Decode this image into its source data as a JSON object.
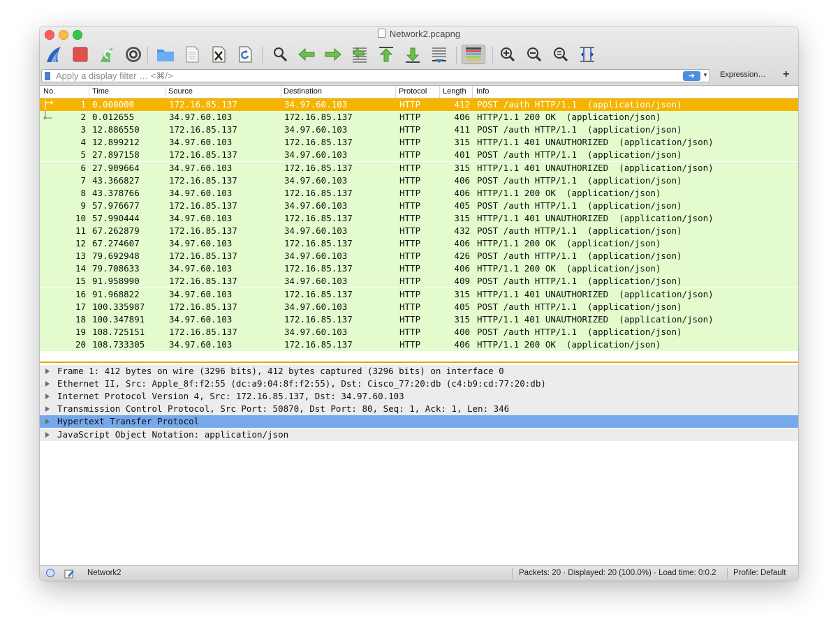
{
  "window": {
    "title": "Network2.pcapng"
  },
  "toolbar": {
    "icons": [
      "shark-fin-icon",
      "stop-icon",
      "restart-icon",
      "gear-icon",
      "folder-icon",
      "file-icon",
      "close-file-icon",
      "reload-icon",
      "search-icon",
      "back-arrow-icon",
      "forward-arrow-icon",
      "go-to-packet-icon",
      "first-packet-icon",
      "last-packet-icon",
      "autoscroll-icon",
      "colorize-icon",
      "zoom-in-icon",
      "zoom-out-icon",
      "zoom-normal-icon",
      "resize-columns-icon"
    ]
  },
  "filter": {
    "placeholder": "Apply a display filter … <⌘/>",
    "expression_label": "Expression…",
    "plus_label": "+"
  },
  "columns": {
    "no": "No.",
    "time": "Time",
    "source": "Source",
    "destination": "Destination",
    "protocol": "Protocol",
    "length": "Length",
    "info": "Info"
  },
  "packets": [
    {
      "no": "1",
      "time": "0.000000",
      "src": "172.16.85.137",
      "dst": "34.97.60.103",
      "proto": "HTTP",
      "len": "412",
      "info": "POST /auth HTTP/1.1  (application/json)"
    },
    {
      "no": "2",
      "time": "0.012655",
      "src": "34.97.60.103",
      "dst": "172.16.85.137",
      "proto": "HTTP",
      "len": "406",
      "info": "HTTP/1.1 200 OK  (application/json)"
    },
    {
      "no": "3",
      "time": "12.886550",
      "src": "172.16.85.137",
      "dst": "34.97.60.103",
      "proto": "HTTP",
      "len": "411",
      "info": "POST /auth HTTP/1.1  (application/json)"
    },
    {
      "no": "4",
      "time": "12.899212",
      "src": "34.97.60.103",
      "dst": "172.16.85.137",
      "proto": "HTTP",
      "len": "315",
      "info": "HTTP/1.1 401 UNAUTHORIZED  (application/json)"
    },
    {
      "no": "5",
      "time": "27.897158",
      "src": "172.16.85.137",
      "dst": "34.97.60.103",
      "proto": "HTTP",
      "len": "401",
      "info": "POST /auth HTTP/1.1  (application/json)"
    },
    {
      "no": "6",
      "time": "27.909664",
      "src": "34.97.60.103",
      "dst": "172.16.85.137",
      "proto": "HTTP",
      "len": "315",
      "info": "HTTP/1.1 401 UNAUTHORIZED  (application/json)"
    },
    {
      "no": "7",
      "time": "43.366827",
      "src": "172.16.85.137",
      "dst": "34.97.60.103",
      "proto": "HTTP",
      "len": "406",
      "info": "POST /auth HTTP/1.1  (application/json)"
    },
    {
      "no": "8",
      "time": "43.378766",
      "src": "34.97.60.103",
      "dst": "172.16.85.137",
      "proto": "HTTP",
      "len": "406",
      "info": "HTTP/1.1 200 OK  (application/json)"
    },
    {
      "no": "9",
      "time": "57.976677",
      "src": "172.16.85.137",
      "dst": "34.97.60.103",
      "proto": "HTTP",
      "len": "405",
      "info": "POST /auth HTTP/1.1  (application/json)"
    },
    {
      "no": "10",
      "time": "57.990444",
      "src": "34.97.60.103",
      "dst": "172.16.85.137",
      "proto": "HTTP",
      "len": "315",
      "info": "HTTP/1.1 401 UNAUTHORIZED  (application/json)"
    },
    {
      "no": "11",
      "time": "67.262879",
      "src": "172.16.85.137",
      "dst": "34.97.60.103",
      "proto": "HTTP",
      "len": "432",
      "info": "POST /auth HTTP/1.1  (application/json)"
    },
    {
      "no": "12",
      "time": "67.274607",
      "src": "34.97.60.103",
      "dst": "172.16.85.137",
      "proto": "HTTP",
      "len": "406",
      "info": "HTTP/1.1 200 OK  (application/json)"
    },
    {
      "no": "13",
      "time": "79.692948",
      "src": "172.16.85.137",
      "dst": "34.97.60.103",
      "proto": "HTTP",
      "len": "426",
      "info": "POST /auth HTTP/1.1  (application/json)"
    },
    {
      "no": "14",
      "time": "79.708633",
      "src": "34.97.60.103",
      "dst": "172.16.85.137",
      "proto": "HTTP",
      "len": "406",
      "info": "HTTP/1.1 200 OK  (application/json)"
    },
    {
      "no": "15",
      "time": "91.958990",
      "src": "172.16.85.137",
      "dst": "34.97.60.103",
      "proto": "HTTP",
      "len": "409",
      "info": "POST /auth HTTP/1.1  (application/json)"
    },
    {
      "no": "16",
      "time": "91.968822",
      "src": "34.97.60.103",
      "dst": "172.16.85.137",
      "proto": "HTTP",
      "len": "315",
      "info": "HTTP/1.1 401 UNAUTHORIZED  (application/json)"
    },
    {
      "no": "17",
      "time": "100.335987",
      "src": "172.16.85.137",
      "dst": "34.97.60.103",
      "proto": "HTTP",
      "len": "405",
      "info": "POST /auth HTTP/1.1  (application/json)"
    },
    {
      "no": "18",
      "time": "100.347891",
      "src": "34.97.60.103",
      "dst": "172.16.85.137",
      "proto": "HTTP",
      "len": "315",
      "info": "HTTP/1.1 401 UNAUTHORIZED  (application/json)"
    },
    {
      "no": "19",
      "time": "108.725151",
      "src": "172.16.85.137",
      "dst": "34.97.60.103",
      "proto": "HTTP",
      "len": "400",
      "info": "POST /auth HTTP/1.1  (application/json)"
    },
    {
      "no": "20",
      "time": "108.733305",
      "src": "34.97.60.103",
      "dst": "172.16.85.137",
      "proto": "HTTP",
      "len": "406",
      "info": "HTTP/1.1 200 OK  (application/json)"
    }
  ],
  "details": [
    "Frame 1: 412 bytes on wire (3296 bits), 412 bytes captured (3296 bits) on interface 0",
    "Ethernet II, Src: Apple_8f:f2:55 (dc:a9:04:8f:f2:55), Dst: Cisco_77:20:db (c4:b9:cd:77:20:db)",
    "Internet Protocol Version 4, Src: 172.16.85.137, Dst: 34.97.60.103",
    "Transmission Control Protocol, Src Port: 50870, Dst Port: 80, Seq: 1, Ack: 1, Len: 346",
    "Hypertext Transfer Protocol",
    "JavaScript Object Notation: application/json"
  ],
  "status": {
    "profile_name": "Network2",
    "packets_text": "Packets: 20 · Displayed: 20 (100.0%) ·  Load time: 0:0.2",
    "profile_text": "Profile: Default"
  },
  "colors": {
    "selected_row": "#f5b400",
    "http_row": "#e4fbcd",
    "highlight_detail": "#76a9ec",
    "accent_blue": "#4a90e2"
  }
}
